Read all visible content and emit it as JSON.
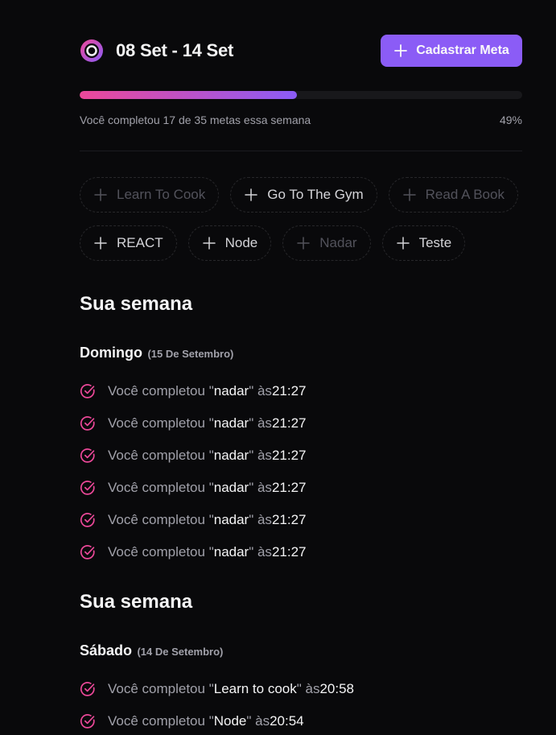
{
  "header": {
    "week_range": "08 Set - 14 Set",
    "create_button_label": "Cadastrar Meta"
  },
  "progress": {
    "summary": "Você completou 17 de 35 metas essa semana",
    "completed": 17,
    "total": 35,
    "percent_label": "49%",
    "fraction": 0.49
  },
  "goals": [
    {
      "label": "Learn To Cook",
      "disabled": true
    },
    {
      "label": "Go To The Gym",
      "disabled": false
    },
    {
      "label": "Read A Book",
      "disabled": true
    },
    {
      "label": "REACT",
      "disabled": false
    },
    {
      "label": "Node",
      "disabled": false
    },
    {
      "label": "Nadar",
      "disabled": true
    },
    {
      "label": "Teste",
      "disabled": false
    }
  ],
  "weeks": [
    {
      "title": "Sua semana",
      "day": "Domingo",
      "date": "(15 De Setembro)",
      "entries": [
        {
          "prefix": "Você completou \"",
          "goal": "nadar",
          "mid": "\" às ",
          "time": "21:27"
        },
        {
          "prefix": "Você completou \"",
          "goal": "nadar",
          "mid": "\" às ",
          "time": "21:27"
        },
        {
          "prefix": "Você completou \"",
          "goal": "nadar",
          "mid": "\" às ",
          "time": "21:27"
        },
        {
          "prefix": "Você completou \"",
          "goal": "nadar",
          "mid": "\" às ",
          "time": "21:27"
        },
        {
          "prefix": "Você completou \"",
          "goal": "nadar",
          "mid": "\" às ",
          "time": "21:27"
        },
        {
          "prefix": "Você completou \"",
          "goal": "nadar",
          "mid": "\" às ",
          "time": "21:27"
        }
      ]
    },
    {
      "title": "Sua semana",
      "day": "Sábado",
      "date": "(14 De Setembro)",
      "entries": [
        {
          "prefix": "Você completou \"",
          "goal": "Learn to cook",
          "mid": "\" às ",
          "time": "20:58"
        },
        {
          "prefix": "Você completou \"",
          "goal": "Node",
          "mid": "\" às ",
          "time": "20:54"
        }
      ]
    }
  ],
  "colors": {
    "background": "#09090b",
    "accent_violet": "#8b5cf6",
    "accent_pink": "#ec4899"
  },
  "icons": {
    "logo": "in-orbit-logo-icon",
    "plus": "plus-icon",
    "check": "circle-check-icon"
  }
}
